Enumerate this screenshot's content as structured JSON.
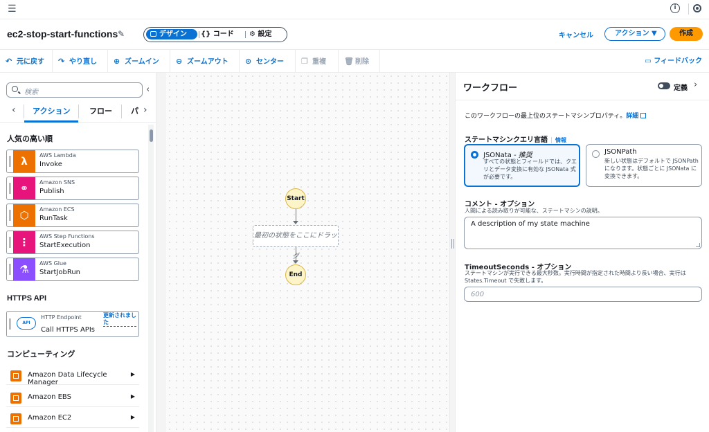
{
  "header": {
    "title": "ec2-stop-start-functions",
    "modes": {
      "design": "デザイン",
      "code": "コード",
      "config": "設定"
    },
    "cancel": "キャンセル",
    "action": "アクション",
    "create": "作成"
  },
  "toolbar": {
    "undo": "元に戻す",
    "redo": "やり直し",
    "zoom_in": "ズームイン",
    "zoom_out": "ズームアウト",
    "center": "センター",
    "duplicate": "重複",
    "delete": "削除",
    "feedback": "フィードバック"
  },
  "left": {
    "search_placeholder": "検索",
    "tabs": [
      "アクション",
      "フロー",
      "パ"
    ],
    "popular_heading": "人気の高い順",
    "cards": [
      {
        "service": "AWS Lambda",
        "action": "Invoke",
        "color": "#ed7100",
        "icon": "lambda-icon"
      },
      {
        "service": "Amazon SNS",
        "action": "Publish",
        "color": "#e7157b",
        "icon": "sns-icon"
      },
      {
        "service": "Amazon ECS",
        "action": "RunTask",
        "color": "#ed7100",
        "icon": "ecs-icon"
      },
      {
        "service": "AWS Step Functions",
        "action": "StartExecution",
        "color": "#e7157b",
        "icon": "step-functions-icon"
      },
      {
        "service": "AWS Glue",
        "action": "StartJobRun",
        "color": "#8c4fff",
        "icon": "glue-icon"
      }
    ],
    "https_heading": "HTTPS API",
    "http_card": {
      "service": "HTTP Endpoint",
      "action": "Call HTTPS APIs",
      "updated": "更新されました",
      "icon_text": "API"
    },
    "compute_heading": "コンピューティング",
    "compute_items": [
      "Amazon Data Lifecycle Manager",
      "Amazon EBS",
      "Amazon EC2"
    ]
  },
  "canvas": {
    "start": "Start",
    "drop": "最初の状態をここにドラッグ",
    "end": "End"
  },
  "right": {
    "title": "ワークフロー",
    "definition": "定義",
    "description": "このワークフローの最上位のステートマシンプロパティ。",
    "details_link": "詳細",
    "query_label": "ステートマシンクエリ言語",
    "info": "情報",
    "options": [
      {
        "title": "JSONata",
        "suffix": " - 推奨",
        "desc": "すべての状態とフィールドでは、クエリとデータ変換に有効な JSONata 式が必要です。"
      },
      {
        "title": "JSONPath",
        "suffix": "",
        "desc": "新しい状態はデフォルトで JSONPath になります。状態ごとに JSONata に変換できます。"
      }
    ],
    "comment_label": "コメント - オプション",
    "comment_hint": "人間による読み取りが可能な、ステートマシンの説明。",
    "comment_value": "A description of my state machine",
    "timeout_label": "TimeoutSeconds - オプション",
    "timeout_hint": "ステートマシンが実行できる最大秒数。実行時間が指定された時間より長い場合、実行は States.Timeout で失敗します。",
    "timeout_placeholder": "600"
  }
}
